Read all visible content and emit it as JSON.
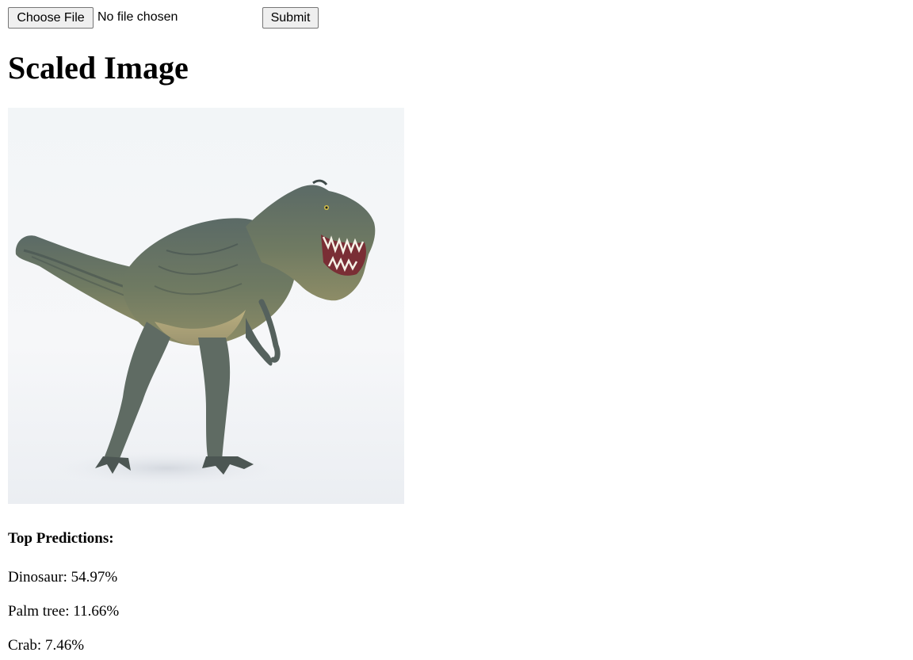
{
  "upload_form": {
    "choose_file_label": "Choose File",
    "file_status": "No file chosen",
    "submit_label": "Submit"
  },
  "page_title": "Scaled Image",
  "image": {
    "icon": "dinosaur-image",
    "subject": "t-rex"
  },
  "predictions": {
    "heading": "Top Predictions:",
    "items": [
      {
        "text": "Dinosaur: 54.97%"
      },
      {
        "text": "Palm tree: 11.66%"
      },
      {
        "text": "Crab: 7.46%"
      }
    ]
  },
  "colors": {
    "button_bg": "#efefef",
    "button_border": "#767676",
    "text": "#000000",
    "background": "#ffffff"
  }
}
